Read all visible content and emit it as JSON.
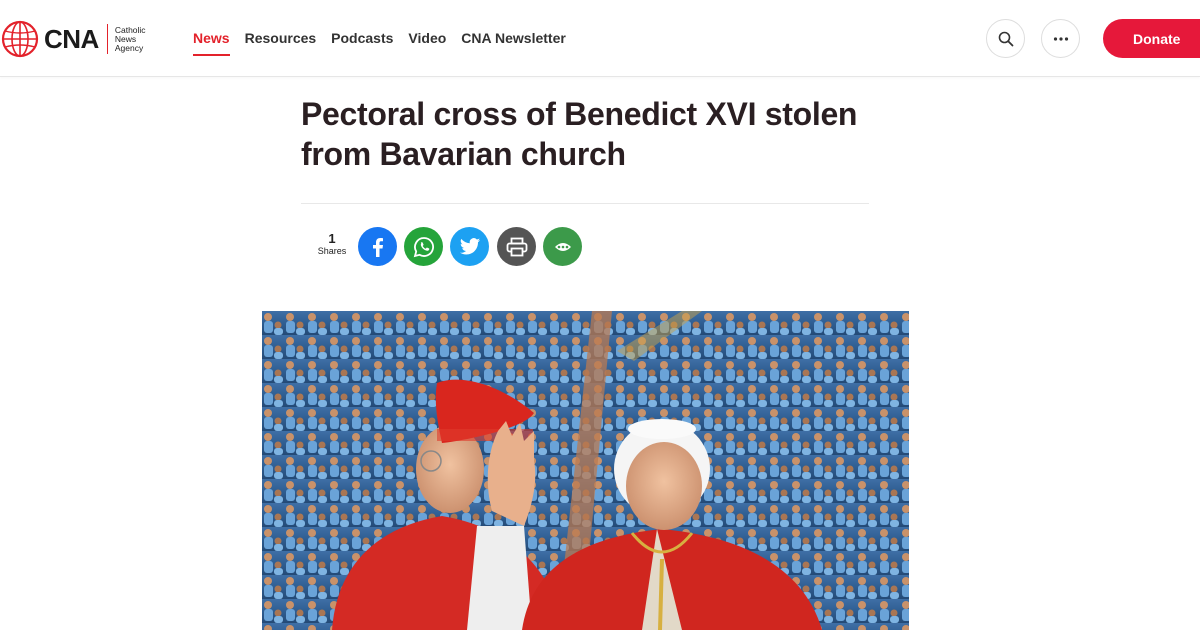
{
  "header": {
    "logo": {
      "name": "CNA",
      "subtitle_lines": [
        "Catholic",
        "News",
        "Agency"
      ]
    },
    "nav": [
      {
        "label": "News",
        "active": true
      },
      {
        "label": "Resources",
        "active": false
      },
      {
        "label": "Podcasts",
        "active": false
      },
      {
        "label": "Video",
        "active": false
      },
      {
        "label": "CNA Newsletter",
        "active": false
      }
    ],
    "search_icon": "search-icon",
    "more_icon": "more-horizontal-icon",
    "donate_label": "Donate"
  },
  "article": {
    "title": "Pectoral cross of Benedict XVI stolen from Bavarian church",
    "shares": {
      "count": "1",
      "label": "Shares"
    },
    "share_buttons": [
      {
        "icon": "facebook-icon",
        "color": "#1877f2"
      },
      {
        "icon": "whatsapp-icon",
        "color": "#25a43a"
      },
      {
        "icon": "twitter-icon",
        "color": "#1da1f2"
      },
      {
        "icon": "print-icon",
        "color": "#555555"
      },
      {
        "icon": "share-more-icon",
        "color": "#3c9a4a"
      }
    ]
  },
  "colors": {
    "accent": "#e3222b",
    "donate": "#e6183a"
  }
}
